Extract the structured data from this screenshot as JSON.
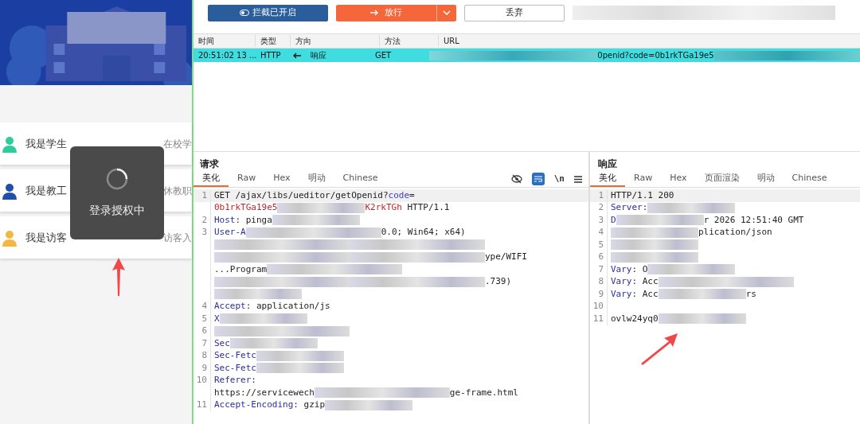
{
  "phone": {
    "roles": [
      {
        "label": "我是学生",
        "note": "在校学",
        "color": "#2ecc9a"
      },
      {
        "label": "我是教工",
        "note": "休教职",
        "color": "#1f4fa8"
      },
      {
        "label": "我是访客",
        "note": "访客入",
        "color": "#f5b642"
      }
    ],
    "toast": {
      "text": "登录授权中"
    }
  },
  "toolbar": {
    "intercept": "拦截已开启",
    "forward": "放行",
    "drop": "丢弃"
  },
  "table": {
    "columns": [
      "时间",
      "类型",
      "方向",
      "方法",
      "URL"
    ],
    "rows": [
      {
        "selected": true,
        "time": "20:51:02 13 ...",
        "type": "HTTP",
        "direction": "响应",
        "method": "GET",
        "url": "0penid?code=0b1rkTGa19e5"
      }
    ]
  },
  "request": {
    "title": "请求",
    "tabs": [
      {
        "label": "美化",
        "selected": true
      },
      {
        "label": "Raw",
        "selected": false
      },
      {
        "label": "Hex",
        "selected": false
      },
      {
        "label": "明动",
        "selected": false
      },
      {
        "label": "Chinese",
        "selected": false
      }
    ],
    "newline_glyph": "\\n",
    "lines": [
      {
        "number": "1",
        "segments": [
          {
            "kind": "plain",
            "text": "GET /ajax/libs/ueditor/getOpenid?"
          },
          {
            "kind": "param",
            "text": "code"
          },
          {
            "kind": "plain",
            "text": "="
          }
        ]
      },
      {
        "segments": [
          {
            "kind": "value",
            "text": "0b1rkTGa19e5"
          },
          {
            "kind": "blur"
          },
          {
            "kind": "value",
            "text": "K2rkTGh"
          },
          {
            "kind": "plain",
            "text": " HTTP/1.1"
          }
        ]
      },
      {
        "number": "2",
        "segments": [
          {
            "kind": "key",
            "text": "Host"
          },
          {
            "kind": "plain",
            "text": ": pinga"
          },
          {
            "kind": "blur"
          }
        ]
      },
      {
        "number": "3",
        "segments": [
          {
            "kind": "key",
            "text": "User-A"
          },
          {
            "kind": "blur-wide"
          },
          {
            "kind": "plain",
            "text": "0.0; Win64; x64)"
          }
        ]
      },
      {
        "segments": [
          {
            "kind": "blur-wide"
          },
          {
            "kind": "blur-wide"
          }
        ]
      },
      {
        "segments": [
          {
            "kind": "blur-wide"
          },
          {
            "kind": "blur-wide"
          },
          {
            "kind": "plain",
            "text": "ype/WIFI"
          }
        ]
      },
      {
        "segments": [
          {
            "kind": "plain",
            "text": "...Program"
          },
          {
            "kind": "blur-wide"
          }
        ]
      },
      {
        "segments": [
          {
            "kind": "blur-wide"
          },
          {
            "kind": "blur-wide"
          },
          {
            "kind": "plain",
            "text": ".739)"
          }
        ]
      },
      {
        "segments": [
          {
            "kind": "blur"
          }
        ]
      },
      {
        "number": "4",
        "segments": [
          {
            "kind": "key",
            "text": "Accept"
          },
          {
            "kind": "plain",
            "text": ": application/js"
          }
        ]
      },
      {
        "number": "5",
        "segments": [
          {
            "kind": "key",
            "text": "X"
          },
          {
            "kind": "blur"
          }
        ]
      },
      {
        "number": "6",
        "segments": [
          {
            "kind": "blur-wide"
          }
        ]
      },
      {
        "number": "7",
        "segments": [
          {
            "kind": "key",
            "text": "Sec"
          },
          {
            "kind": "blur"
          }
        ]
      },
      {
        "number": "8",
        "segments": [
          {
            "kind": "key",
            "text": "Sec-Fetc"
          },
          {
            "kind": "blur"
          }
        ]
      },
      {
        "number": "9",
        "segments": [
          {
            "kind": "key",
            "text": "Sec-Fetc"
          },
          {
            "kind": "blur"
          }
        ]
      },
      {
        "number": "10",
        "segments": [
          {
            "kind": "key",
            "text": "Referer"
          },
          {
            "kind": "plain",
            "text": ":"
          }
        ]
      },
      {
        "segments": [
          {
            "kind": "plain",
            "text": "https://servicewech"
          },
          {
            "kind": "blur-wide"
          },
          {
            "kind": "plain",
            "text": "ge-frame.html"
          }
        ]
      },
      {
        "number": "11",
        "segments": [
          {
            "kind": "key",
            "text": "Accept-Encoding"
          },
          {
            "kind": "plain",
            "text": ": gzip"
          },
          {
            "kind": "blur"
          }
        ]
      }
    ]
  },
  "response": {
    "title": "响应",
    "tabs": [
      {
        "label": "美化",
        "selected": true
      },
      {
        "label": "Raw",
        "selected": false
      },
      {
        "label": "Hex",
        "selected": false
      },
      {
        "label": "页面渲染",
        "selected": false
      },
      {
        "label": "明动",
        "selected": false
      },
      {
        "label": "Chinese",
        "selected": false
      }
    ],
    "lines": [
      {
        "number": "1",
        "segments": [
          {
            "kind": "plain",
            "text": "HTTP/1.1 200"
          }
        ]
      },
      {
        "number": "2",
        "segments": [
          {
            "kind": "key",
            "text": "Server"
          },
          {
            "kind": "plain",
            "text": ":"
          },
          {
            "kind": "blur"
          }
        ]
      },
      {
        "number": "3",
        "segments": [
          {
            "kind": "key",
            "text": "D"
          },
          {
            "kind": "blur"
          },
          {
            "kind": "plain",
            "text": "r 2026 12:51:40 GMT"
          }
        ]
      },
      {
        "number": "4",
        "segments": [
          {
            "kind": "blur"
          },
          {
            "kind": "plain",
            "text": "plication/json"
          }
        ]
      },
      {
        "number": "5",
        "segments": [
          {
            "kind": "blur"
          }
        ]
      },
      {
        "number": "6",
        "segments": [
          {
            "kind": "blur"
          }
        ]
      },
      {
        "number": "7",
        "segments": [
          {
            "kind": "key",
            "text": "Vary"
          },
          {
            "kind": "plain",
            "text": ": O"
          },
          {
            "kind": "blur"
          }
        ]
      },
      {
        "number": "8",
        "segments": [
          {
            "kind": "key",
            "text": "Vary"
          },
          {
            "kind": "plain",
            "text": ": Acc"
          },
          {
            "kind": "blur-wide"
          }
        ]
      },
      {
        "number": "9",
        "segments": [
          {
            "kind": "key",
            "text": "Vary"
          },
          {
            "kind": "plain",
            "text": ": Acc"
          },
          {
            "kind": "blur"
          },
          {
            "kind": "plain",
            "text": "rs"
          }
        ]
      },
      {
        "number": "10"
      },
      {
        "number": "11",
        "segments": [
          {
            "kind": "plain",
            "text": "ovlw24yq0"
          },
          {
            "kind": "blur"
          }
        ]
      }
    ]
  }
}
